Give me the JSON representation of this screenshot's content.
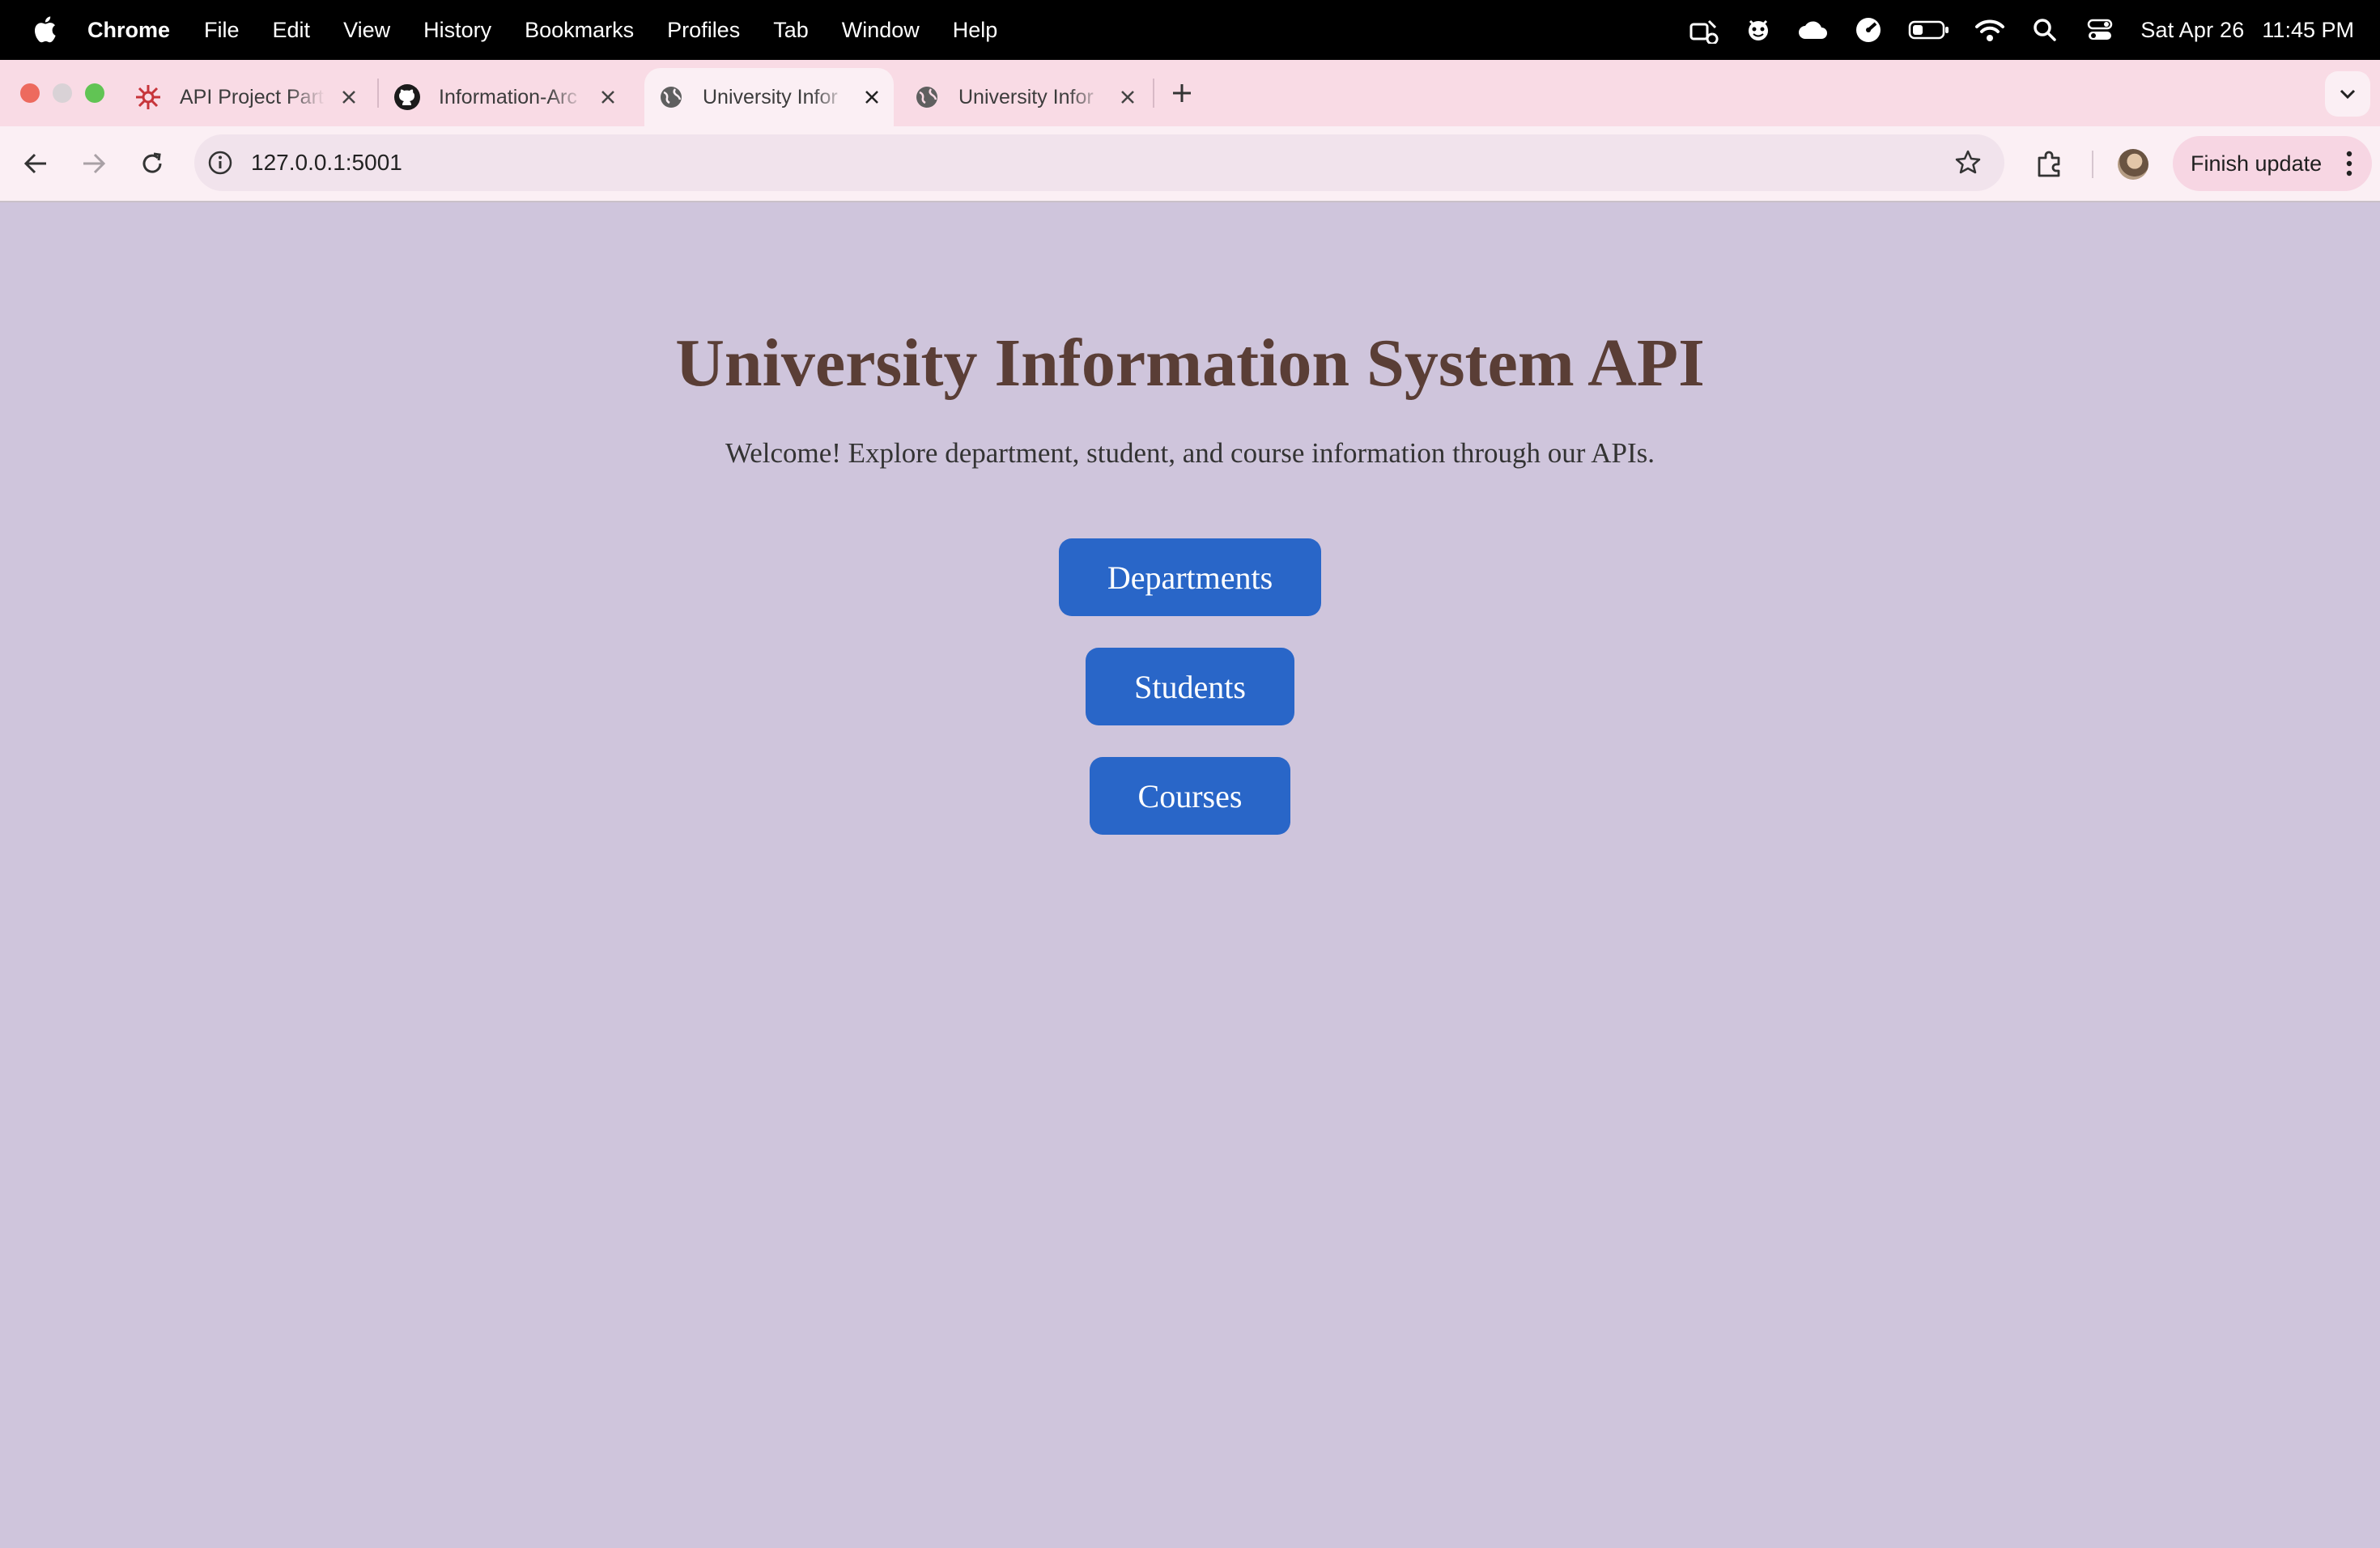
{
  "menubar": {
    "app": "Chrome",
    "menus": [
      "File",
      "Edit",
      "View",
      "History",
      "Bookmarks",
      "Profiles",
      "Tab",
      "Window",
      "Help"
    ],
    "date": "Sat Apr 26",
    "time": "11:45 PM"
  },
  "tabs": [
    {
      "title": "API Project Part",
      "icon": "asu-logo-icon",
      "active": false
    },
    {
      "title": "Information-Arc",
      "icon": "github-icon",
      "active": false
    },
    {
      "title": "University Infor",
      "icon": "globe-icon",
      "active": true
    },
    {
      "title": "University Infor",
      "icon": "globe-icon",
      "active": false
    }
  ],
  "toolbar": {
    "url": "127.0.0.1:5001",
    "update_label": "Finish update"
  },
  "page": {
    "title": "University Information System API",
    "subtitle": "Welcome! Explore department, student, and course information through our APIs.",
    "buttons": [
      "Departments",
      "Students",
      "Courses"
    ],
    "button_color": "#2966c8",
    "title_color": "#5a3e36",
    "background_color": "#cfc5dc"
  }
}
